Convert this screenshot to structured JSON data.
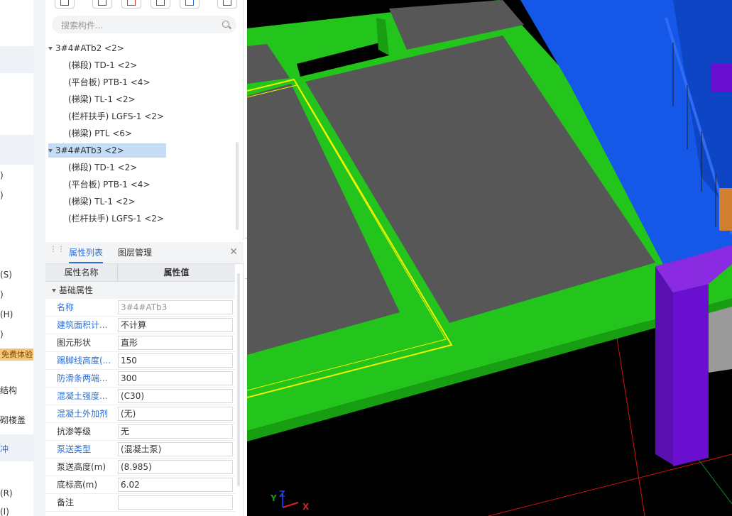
{
  "left_nav": {
    "labels": [
      {
        "text": ")"
      },
      {
        "text": ")"
      },
      {
        "text": "(S)"
      },
      {
        "text": ")"
      },
      {
        "text": "(H)"
      },
      {
        "text": ")"
      },
      {
        "text": "结构"
      },
      {
        "text": "砌楼盖"
      },
      {
        "text": "冲"
      },
      {
        "text": "(R)"
      },
      {
        "text": "(I)"
      }
    ],
    "promo": "免费体验"
  },
  "tree": {
    "search_placeholder": "搜索构件...",
    "nodes": [
      {
        "label": "3#4#ATb2 <2>"
      },
      {
        "label": "(梯段) TD-1 <2>"
      },
      {
        "label": "(平台板) PTB-1 <4>"
      },
      {
        "label": "(梯梁) TL-1 <2>"
      },
      {
        "label": "(栏杆扶手) LGFS-1 <2>"
      },
      {
        "label": "(梯梁) PTL <6>"
      },
      {
        "label": "3#4#ATb3 <2>"
      },
      {
        "label": "(梯段) TD-1 <2>"
      },
      {
        "label": "(平台板) PTB-1 <4>"
      },
      {
        "label": "(梯梁) TL-1 <2>"
      },
      {
        "label": "(栏杆扶手) LGFS-1 <2>"
      }
    ]
  },
  "props": {
    "tabs": [
      "属性列表",
      "图层管理"
    ],
    "col_name": "属性名称",
    "col_value": "属性值",
    "group": "基础属性",
    "rows": [
      {
        "name": "名称",
        "value": "3#4#ATb3"
      },
      {
        "name": "建筑面积计...",
        "value": "不计算"
      },
      {
        "name": "图元形状",
        "value": "直形"
      },
      {
        "name": "踢脚线高度(...",
        "value": "150"
      },
      {
        "name": "防滑条两端...",
        "value": "300"
      },
      {
        "name": "混凝土强度...",
        "value": "(C30)"
      },
      {
        "name": "混凝土外加剂",
        "value": "(无)"
      },
      {
        "name": "抗渗等级",
        "value": "无"
      },
      {
        "name": "泵送类型",
        "value": "(混凝土泵)"
      },
      {
        "name": "泵送高度(m)",
        "value": "(8.985)"
      },
      {
        "name": "底标高(m)",
        "value": "6.02"
      },
      {
        "name": "备注",
        "value": ""
      }
    ]
  },
  "axis": {
    "x": "X",
    "y": "Y",
    "z": "Z"
  },
  "colors": {
    "accent": "#2a6fdb",
    "selection": "#c4dcf5",
    "slab_green": "#23c41b",
    "stair_blue": "#1557e6",
    "column_purple": "#6a0fd0",
    "floor_gray": "#575757",
    "edge_yellow": "#f2f200"
  }
}
